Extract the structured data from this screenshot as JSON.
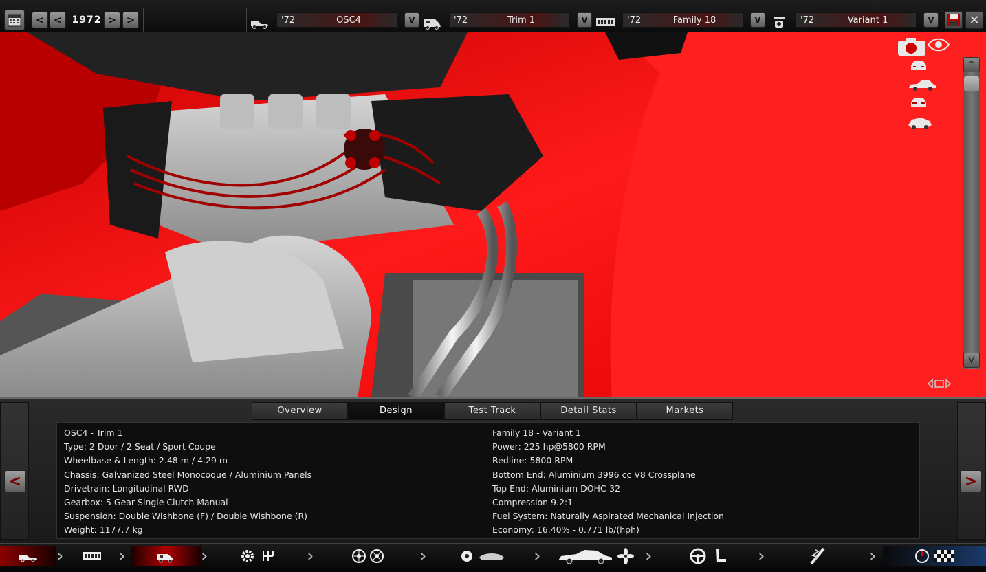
{
  "toolbar": {
    "year": "1972",
    "prev_fast": "<",
    "prev": "<",
    "next": ">",
    "next_fast": ">",
    "dropdown_glyph": "V",
    "close_glyph": "✕"
  },
  "selectors": [
    {
      "icon": "car-model-icon",
      "year": "'72",
      "name": "OSC4"
    },
    {
      "icon": "trim-icon",
      "year": "'72",
      "name": "Trim 1"
    },
    {
      "icon": "engine-family-icon",
      "year": "'72",
      "name": "Family 18"
    },
    {
      "icon": "engine-variant-icon",
      "year": "'72",
      "name": "Variant 1"
    }
  ],
  "view_controls": {
    "scroll_up": "^",
    "scroll_down": "V"
  },
  "tabs": [
    "Overview",
    "Design",
    "Test Track",
    "Detail Stats",
    "Markets"
  ],
  "active_tab": "Design",
  "side_nav": {
    "prev": "<",
    "next": ">"
  },
  "stats": {
    "left": [
      "OSC4 - Trim 1",
      "Type: 2 Door / 2 Seat / Sport Coupe",
      "Wheelbase & Length: 2.48 m / 4.29 m",
      "Chassis: Galvanized Steel Monocoque / Aluminium Panels",
      "Drivetrain: Longitudinal RWD",
      "Gearbox: 5 Gear Single Clutch Manual",
      "Suspension: Double Wishbone (F) / Double Wishbone (R)",
      "Weight: 1177.7 kg"
    ],
    "right": [
      "Family 18 - Variant 1",
      "Power: 225 hp@5800 RPM",
      "Redline: 5800 RPM",
      "Bottom End: Aluminium 3996 cc V8 Crossplane",
      "Top End: Aluminium DOHC-32",
      "Compression 9.2:1",
      "Fuel System: Naturally Aspirated Mechanical Injection",
      "Economy: 16.40% - 0.771 lb/(hph)"
    ]
  },
  "bottom_nav": [
    {
      "name": "model-step",
      "icons": [
        "car-body-icon"
      ]
    },
    {
      "name": "engine-family-step",
      "icons": [
        "engine-block-icon"
      ]
    },
    {
      "name": "trim-step",
      "icons": [
        "car-trim-icon"
      ],
      "active": true
    },
    {
      "name": "drivetrain-step",
      "icons": [
        "gear-icon",
        "gearshift-icon"
      ]
    },
    {
      "name": "wheels-step",
      "icons": [
        "wheel-icon",
        "wheel-icon"
      ]
    },
    {
      "name": "brakes-step",
      "icons": [
        "brake-disc-icon",
        "brake-pad-icon"
      ]
    },
    {
      "name": "body-step",
      "icons": [
        "sports-car-icon",
        "fan-icon"
      ]
    },
    {
      "name": "interior-step",
      "icons": [
        "steering-wheel-icon",
        "seat-icon"
      ]
    },
    {
      "name": "suspension-step",
      "icons": [
        "suspension-icon"
      ]
    },
    {
      "name": "test-step",
      "icons": [
        "gauge-icon",
        "checkered-flag-icon"
      ]
    }
  ],
  "colors": {
    "accent_red": "#e00000",
    "field_red": "#4a1414",
    "active_nav": "#b00000"
  }
}
